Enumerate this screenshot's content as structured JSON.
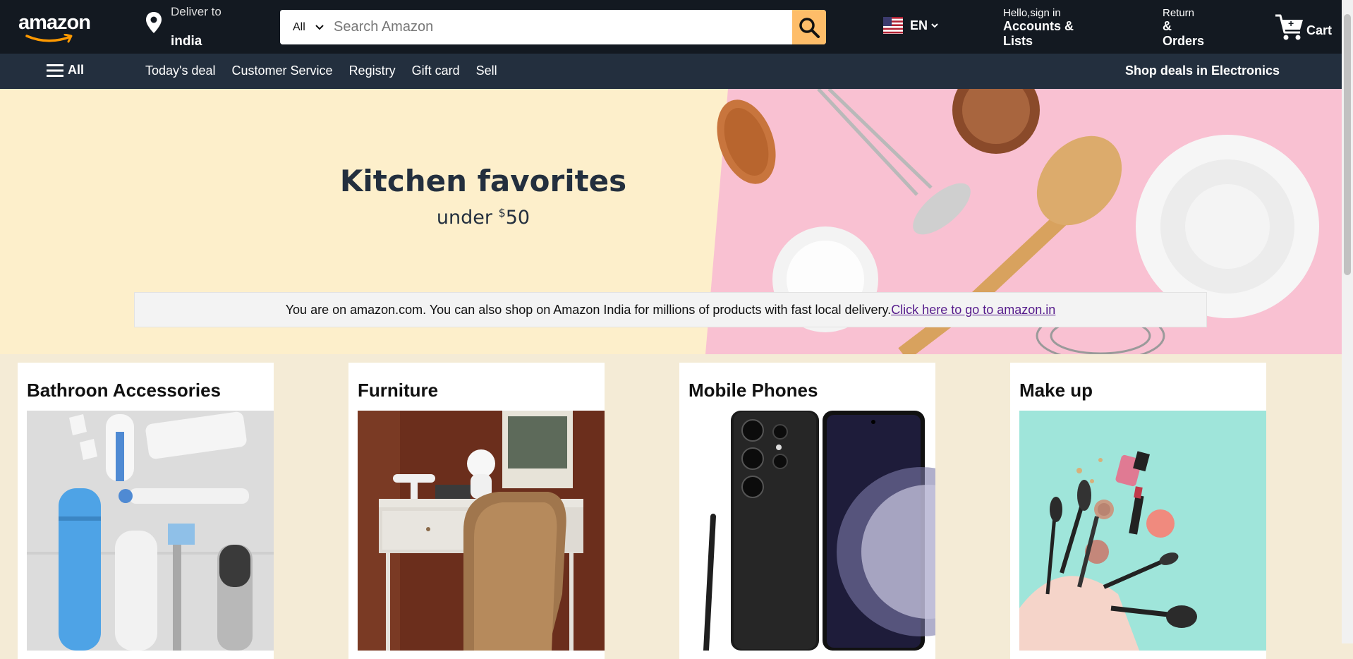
{
  "header": {
    "logo": "amazon",
    "deliver": {
      "line1": "Deliver to",
      "location": "india"
    },
    "search": {
      "category": "All",
      "placeholder": "Search Amazon"
    },
    "language": "EN",
    "account": {
      "line1": "Hello,sign in",
      "line2": "Accounts & Lists"
    },
    "orders": {
      "line1": "Return",
      "line2": "& Orders"
    },
    "cart": "Cart"
  },
  "subnav": {
    "all": "All",
    "links": [
      "Today's deal",
      "Customer Service",
      "Registry",
      "Gift card",
      "Sell"
    ],
    "deals": "Shop deals in Electronics"
  },
  "hero": {
    "title": "Kitchen favorites",
    "subtitle_prefix": "under ",
    "currency": "$",
    "amount": "50"
  },
  "notice": {
    "text": "You are on amazon.com. You can also shop on Amazon India for millions of products with fast local delivery.",
    "link": "Click here to go to amazon.in"
  },
  "cards": [
    {
      "title": "Bathroon Accessories"
    },
    {
      "title": "Furniture"
    },
    {
      "title": "Mobile Phones"
    },
    {
      "title": "Make up"
    }
  ],
  "colors": {
    "header": "#131921",
    "subnav": "#232f3e",
    "search_button": "#febd69",
    "hero_bg": "#fdefcb",
    "page_bg": "#f4ebd6"
  }
}
